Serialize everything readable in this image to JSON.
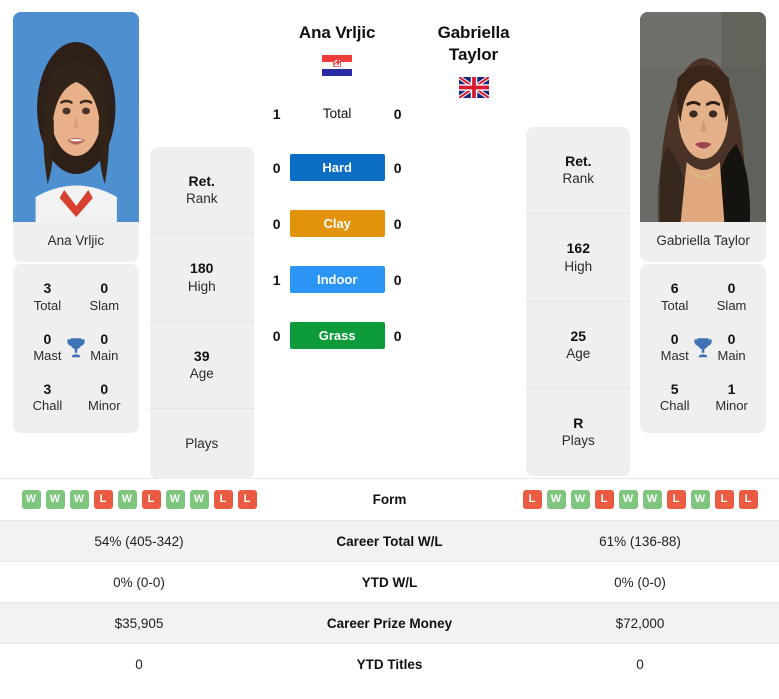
{
  "players": {
    "left": {
      "name": "Ana Vrljic",
      "photo_caption": "Ana Vrljic",
      "flag": "croatia-flag",
      "rank": {
        "value": "Ret.",
        "label": "Rank"
      },
      "high": {
        "value": "180",
        "label": "High"
      },
      "age": {
        "value": "39",
        "label": "Age"
      },
      "plays": {
        "value": "",
        "label": "Plays"
      },
      "titles": {
        "total": {
          "value": "3",
          "label": "Total"
        },
        "slam": {
          "value": "0",
          "label": "Slam"
        },
        "mast": {
          "value": "0",
          "label": "Mast"
        },
        "main": {
          "value": "0",
          "label": "Main"
        },
        "chall": {
          "value": "3",
          "label": "Chall"
        },
        "minor": {
          "value": "0",
          "label": "Minor"
        }
      },
      "h2h": {
        "total": "1",
        "hard": "0",
        "clay": "0",
        "indoor": "1",
        "grass": "0"
      },
      "form": [
        "W",
        "W",
        "W",
        "L",
        "W",
        "L",
        "W",
        "W",
        "L",
        "L"
      ],
      "career_total_wl": "54% (405-342)",
      "ytd_wl": "0% (0-0)",
      "career_prize_money": "$35,905",
      "ytd_titles": "0"
    },
    "right": {
      "name": "Gabriella Taylor",
      "photo_caption": "Gabriella Taylor",
      "flag": "united-kingdom-flag",
      "rank": {
        "value": "Ret.",
        "label": "Rank"
      },
      "high": {
        "value": "162",
        "label": "High"
      },
      "age": {
        "value": "25",
        "label": "Age"
      },
      "plays": {
        "value": "R",
        "label": "Plays"
      },
      "titles": {
        "total": {
          "value": "6",
          "label": "Total"
        },
        "slam": {
          "value": "0",
          "label": "Slam"
        },
        "mast": {
          "value": "0",
          "label": "Mast"
        },
        "main": {
          "value": "0",
          "label": "Main"
        },
        "chall": {
          "value": "5",
          "label": "Chall"
        },
        "minor": {
          "value": "1",
          "label": "Minor"
        }
      },
      "h2h": {
        "total": "0",
        "hard": "0",
        "clay": "0",
        "indoor": "0",
        "grass": "0"
      },
      "form": [
        "L",
        "W",
        "W",
        "L",
        "W",
        "W",
        "L",
        "W",
        "L",
        "L"
      ],
      "career_total_wl": "61% (136-88)",
      "ytd_wl": "0% (0-0)",
      "career_prize_money": "$72,000",
      "ytd_titles": "0"
    }
  },
  "surfaces": {
    "total_label": "Total",
    "hard_label": "Hard",
    "clay_label": "Clay",
    "indoor_label": "Indoor",
    "grass_label": "Grass",
    "colors": {
      "hard": "#0b6ec4",
      "clay": "#e2930c",
      "indoor": "#2b95f5",
      "grass": "#0d9b3c"
    }
  },
  "table": {
    "rows": [
      {
        "label": "Form"
      },
      {
        "label": "Career Total W/L"
      },
      {
        "label": "YTD W/L"
      },
      {
        "label": "Career Prize Money"
      },
      {
        "label": "YTD Titles"
      }
    ]
  },
  "theme": {
    "card_bg": "#efefef",
    "win_color": "#7ec67e",
    "loss_color": "#eb5b42",
    "trophy_color": "#3f72b5"
  }
}
